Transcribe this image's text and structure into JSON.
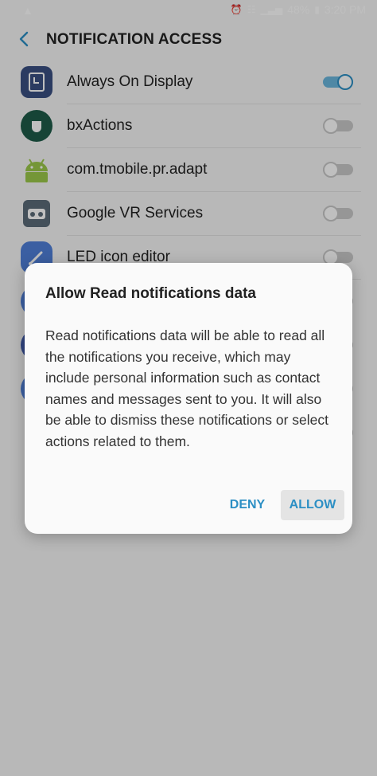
{
  "status_bar": {
    "battery": "48%",
    "time": "3:20 PM"
  },
  "header": {
    "title": "NOTIFICATION ACCESS"
  },
  "apps": [
    {
      "name": "Always On Display",
      "icon": "always-on-display-icon",
      "enabled": true,
      "icon_color": "#3a4f82"
    },
    {
      "name": "bxActions",
      "icon": "bxactions-icon",
      "enabled": false,
      "icon_color": "#1e5b48"
    },
    {
      "name": "com.tmobile.pr.adapt",
      "icon": "android-icon",
      "enabled": false,
      "icon_color": "#9bc94a"
    },
    {
      "name": "Google VR Services",
      "icon": "vr-headset-icon",
      "enabled": false,
      "icon_color": "#5b6b78"
    },
    {
      "name": "LED icon editor",
      "icon": "pencil-icon",
      "enabled": false,
      "icon_color": "#4f7fd9"
    }
  ],
  "dialog": {
    "title": "Allow Read notifications data",
    "body": "Read notifications data will be able to read all the notifications you receive, which may include personal information such as contact names and messages sent to you. It will also be able to dismiss these notifications or select actions related to them.",
    "deny_label": "DENY",
    "allow_label": "ALLOW"
  },
  "colors": {
    "accent": "#2c8fc4",
    "toggle_on": "#6ab6dd"
  }
}
